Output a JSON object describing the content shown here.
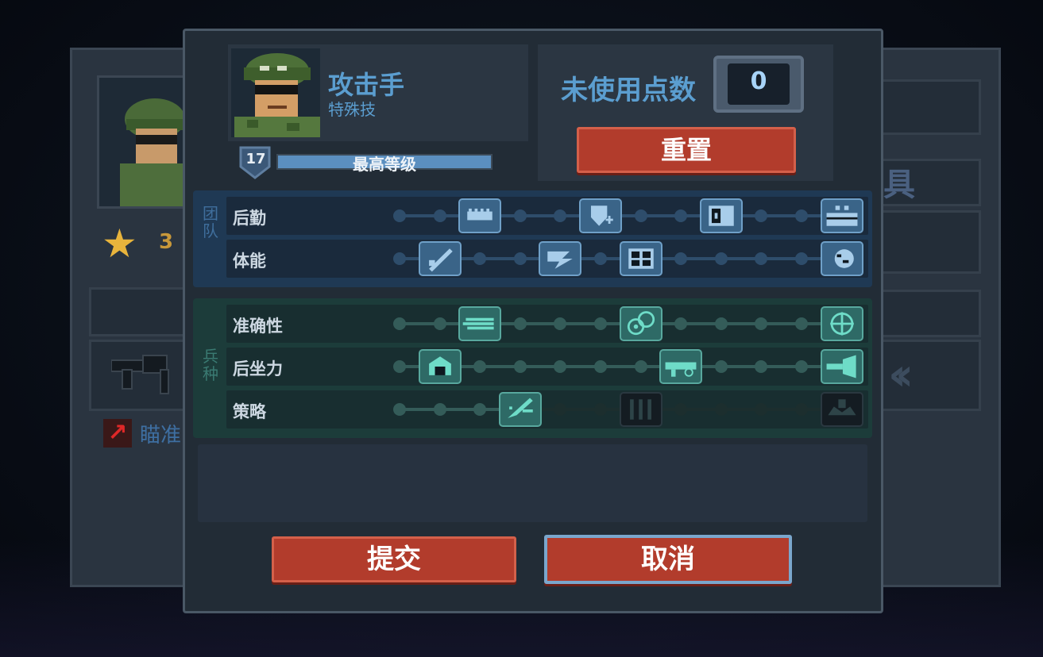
{
  "background": {
    "star_count": "3",
    "left_weapon_label": "瞄准"
  },
  "header": {
    "class_name": "攻击手",
    "class_subtitle": "特殊技",
    "level": "17",
    "level_text": "最高等级",
    "level_progress": 1.0
  },
  "points": {
    "label": "未使用点数",
    "value": "0",
    "reset_label": "重置"
  },
  "sections": [
    {
      "name": "团队",
      "theme": "team",
      "rows": [
        {
          "label": "后勤",
          "icon_positions": [
            2,
            5,
            8,
            11
          ],
          "icons": [
            "grid-ammo-icon",
            "shield-plus-icon",
            "medkit-icon",
            "supply-crate-icon"
          ],
          "active_until": 11
        },
        {
          "label": "体能",
          "icon_positions": [
            1,
            4,
            6,
            11
          ],
          "icons": [
            "knife-icon",
            "sprint-icon",
            "armor-vest-icon",
            "brain-icon"
          ],
          "active_until": 11
        }
      ]
    },
    {
      "name": "兵种",
      "theme": "arm",
      "rows": [
        {
          "label": "准确性",
          "icon_positions": [
            2,
            6,
            11
          ],
          "icons": [
            "bullet-streak-icon",
            "double-target-icon",
            "crosshair-icon"
          ],
          "active_until": 11
        },
        {
          "label": "后坐力",
          "icon_positions": [
            1,
            7,
            11
          ],
          "icons": [
            "gun-mount-icon",
            "rifle-grip-icon",
            "muzzle-icon"
          ],
          "active_until": 11
        },
        {
          "label": "策略",
          "icon_positions": [
            3,
            6,
            11
          ],
          "icons": [
            "airstrike-icon",
            "claw-icon",
            "drone-icon"
          ],
          "active_until": 3
        }
      ]
    }
  ],
  "actions": {
    "submit_label": "提交",
    "cancel_label": "取消"
  },
  "colors": {
    "accent_blue": "#5b9ed0",
    "button_red": "#b23c2c",
    "team_node": "#2c4c6a",
    "arm_node": "#335a58"
  }
}
